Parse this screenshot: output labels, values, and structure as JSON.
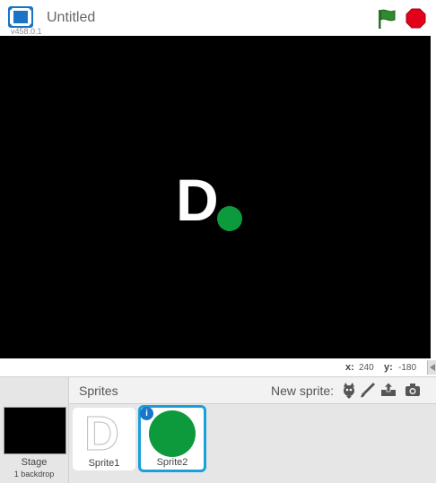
{
  "header": {
    "title": "Untitled",
    "version": "v458.0.1"
  },
  "coords": {
    "x_label": "x:",
    "x_value": "240",
    "y_label": "y:",
    "y_value": "-180"
  },
  "sprite_panel": {
    "title": "Sprites",
    "new_sprite_label": "New sprite:",
    "new_sprite_icons": [
      "choose-from-library-icon",
      "paint-brush-icon",
      "upload-icon",
      "camera-icon"
    ]
  },
  "stage_item": {
    "name": "Stage",
    "backdrops": "1 backdrop"
  },
  "sprites": [
    {
      "name": "Sprite1",
      "selected": false
    },
    {
      "name": "Sprite2",
      "selected": true
    }
  ],
  "stage_content": {
    "letter": "D"
  },
  "colors": {
    "stage_bg": "#000000",
    "sprite_green": "#0c9a3c",
    "flag_green": "#2e8b2e",
    "stop_red": "#e2001a",
    "selected_border": "#1aa0d8"
  }
}
